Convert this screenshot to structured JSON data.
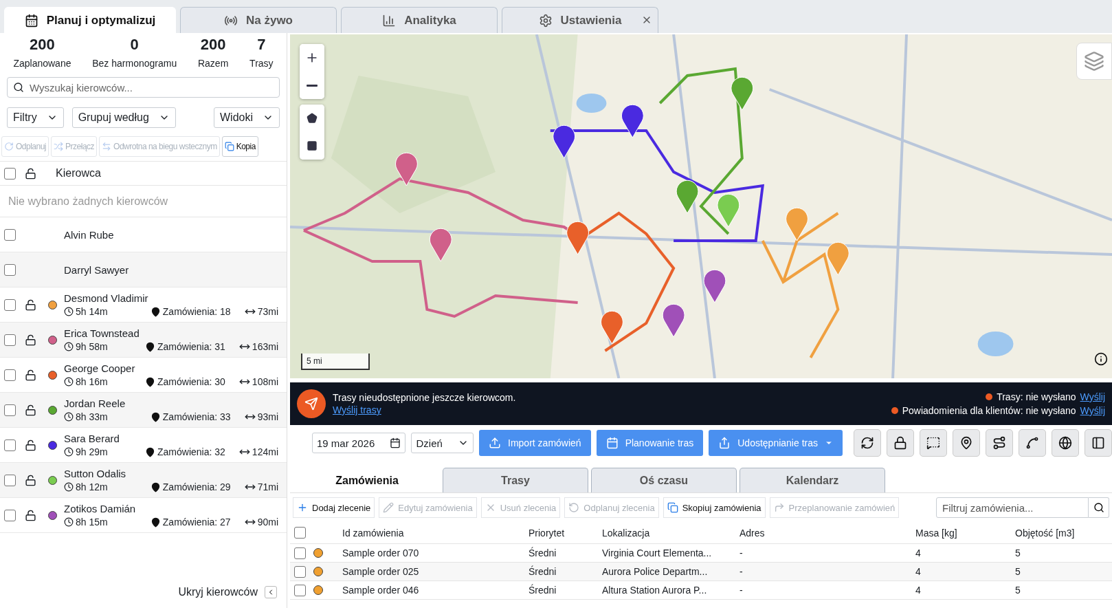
{
  "main_tabs": [
    {
      "label": "Planuj i optymalizuj",
      "selected": true
    },
    {
      "label": "Na żywo",
      "selected": false
    },
    {
      "label": "Analityka",
      "selected": false
    },
    {
      "label": "Ustawienia",
      "selected": false
    }
  ],
  "stats": [
    {
      "value": "200",
      "label": "Zaplanowane"
    },
    {
      "value": "0",
      "label": "Bez harmonogramu"
    },
    {
      "value": "200",
      "label": "Razem"
    },
    {
      "value": "7",
      "label": "Trasy"
    }
  ],
  "driver_search": {
    "placeholder": "Wyszukaj kierowców..."
  },
  "filters": [
    "Filtry",
    "Grupuj według"
  ],
  "views": "Widoki",
  "driver_actions": [
    {
      "label": "Odplanuj",
      "disabled": true
    },
    {
      "label": "Przełącz",
      "disabled": true
    },
    {
      "label": "Odwrotna na biegu wstecznym",
      "disabled": true
    },
    {
      "label": "Kopia",
      "disabled": false
    }
  ],
  "driver_table": {
    "all_checked": false,
    "header": "Kierowca",
    "empty_note": "Nie wybrano żadnych kierowców",
    "drivers": [
      {
        "name": "Alvin Rube",
        "checked": false
      },
      {
        "name": "Darryl Sawyer",
        "checked": false
      },
      {
        "name": "Desmond Vladimir",
        "checked": false,
        "color": "#f0a040",
        "time": "5h 14m",
        "orders": "Zamówienia: 18",
        "distance": "73mi"
      },
      {
        "name": "Erica Townstead",
        "checked": false,
        "color": "#d0608a",
        "time": "9h 58m",
        "orders": "Zamówienia: 31",
        "distance": "163mi"
      },
      {
        "name": "George Cooper",
        "checked": false,
        "color": "#e8602a",
        "time": "8h 16m",
        "orders": "Zamówienia: 30",
        "distance": "108mi"
      },
      {
        "name": "Jordan Reele",
        "checked": false,
        "color": "#5aa832",
        "time": "8h 33m",
        "orders": "Zamówienia: 33",
        "distance": "93mi"
      },
      {
        "name": "Sara Berard",
        "checked": false,
        "color": "#4a2ae0",
        "time": "9h 29m",
        "orders": "Zamówienia: 32",
        "distance": "124mi"
      },
      {
        "name": "Sutton Odalis",
        "checked": false,
        "color": "#7acc50",
        "time": "8h 12m",
        "orders": "Zamówienia: 29",
        "distance": "71mi"
      },
      {
        "name": "Zotikos Damián",
        "checked": false,
        "color": "#a050b8",
        "time": "8h 15m",
        "orders": "Zamówienia: 27",
        "distance": "90mi"
      }
    ]
  },
  "hide_drivers": "Ukryj kierowców",
  "map": {
    "kind": "picture",
    "scale": "5 mi"
  },
  "notice": {
    "message": "Trasy nieudostępnione jeszcze kierowcom.",
    "link": "Wyślij trasy",
    "statuses": [
      {
        "text": "Trasy: nie wysłano",
        "link": "Wyślij"
      },
      {
        "text": "Powiadomienia dla klientów: nie wysłano",
        "link": "Wyślij"
      }
    ]
  },
  "date": "19 mar 2026",
  "period": "Dzień",
  "primary_buttons": [
    "Import zamówień",
    "Planowanie tras",
    "Udostępnianie tras"
  ],
  "order_tabs": [
    {
      "label": "Zamówienia",
      "selected": true
    },
    {
      "label": "Trasy",
      "selected": false
    },
    {
      "label": "Oś czasu",
      "selected": false
    },
    {
      "label": "Kalendarz",
      "selected": false
    }
  ],
  "order_actions": [
    {
      "label": "Dodaj zlecenie",
      "disabled": false
    },
    {
      "label": "Edytuj zamówienia",
      "disabled": true
    },
    {
      "label": "Usuń zlecenia",
      "disabled": true
    },
    {
      "label": "Odplanuj zlecenia",
      "disabled": true
    },
    {
      "label": "Skopiuj zamówienia",
      "disabled": false
    },
    {
      "label": "Przeplanowanie zamówień",
      "disabled": true
    }
  ],
  "order_filter": {
    "placeholder": "Filtruj zamówienia..."
  },
  "orders": {
    "all_checked": false,
    "columns": [
      "Id zamówienia",
      "Priorytet",
      "Lokalizacja",
      "Adres",
      "Masa [kg]",
      "Objętość [m3]"
    ],
    "rows": [
      {
        "checked": false,
        "color": "#f0a030",
        "cells": [
          "Sample order 070",
          "Średni",
          "Virginia Court Elementa...",
          "-",
          "4",
          "5"
        ]
      },
      {
        "checked": false,
        "color": "#f0a030",
        "cells": [
          "Sample order 025",
          "Średni",
          "Aurora Police Departm...",
          "-",
          "4",
          "5"
        ]
      },
      {
        "checked": false,
        "color": "#f0a030",
        "cells": [
          "Sample order 046",
          "Średni",
          "Altura Station Aurora P...",
          "-",
          "4",
          "5"
        ]
      }
    ]
  }
}
